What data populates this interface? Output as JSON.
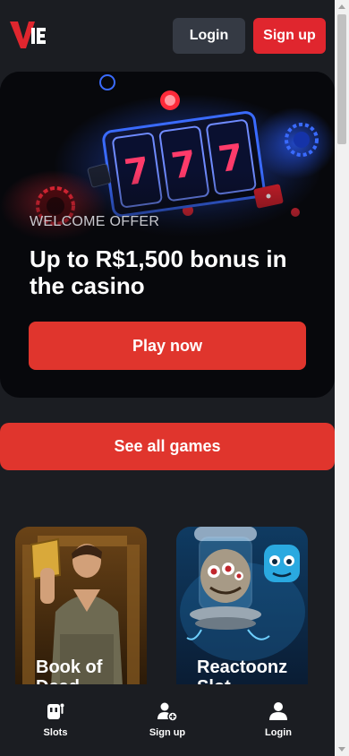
{
  "header": {
    "login_label": "Login",
    "signup_label": "Sign up"
  },
  "hero": {
    "eyebrow": "WELCOME OFFER",
    "title": "Up to R$1,500 bonus in the casino",
    "cta_label": "Play now",
    "reel_digits": [
      "7",
      "7",
      "7"
    ]
  },
  "see_all_label": "See all games",
  "games": [
    {
      "title": "Book of Dead"
    },
    {
      "title": "Reactoonz Slot"
    }
  ],
  "bottom_nav": [
    {
      "label": "Slots",
      "icon": "slot-machine-icon"
    },
    {
      "label": "Sign up",
      "icon": "add-user-icon"
    },
    {
      "label": "Login",
      "icon": "user-icon"
    }
  ],
  "colors": {
    "background": "#1b1d22",
    "accent": "#e0262e",
    "button_secondary": "#353a44",
    "hero_background": "#07080c"
  }
}
